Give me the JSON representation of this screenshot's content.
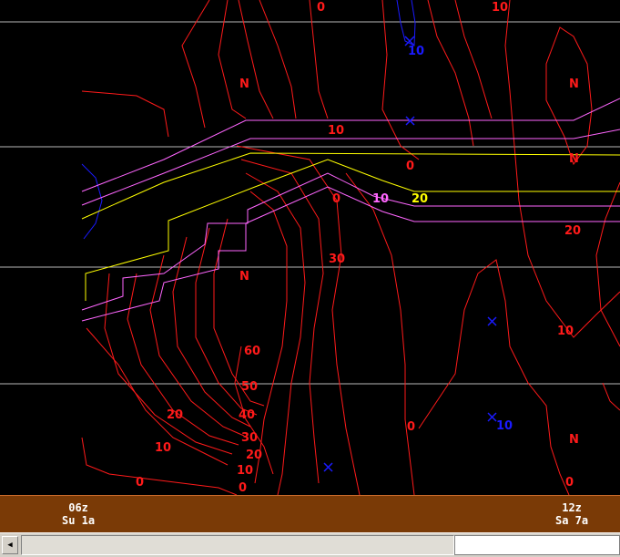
{
  "colors": {
    "background": "#000000",
    "red_contours": "#ff1a1a",
    "blue_contours": "#1a1aff",
    "violet_contours": "#ff66ff",
    "yellow_contours": "#ffff00",
    "grid": "#b8b8b8",
    "timebar": "#7a3a06"
  },
  "plot": {
    "red_labels": [
      "0",
      "10",
      "N",
      "N",
      "10",
      "N",
      "0",
      "20",
      "0",
      "30",
      "N",
      "60",
      "10",
      "50",
      "40",
      "20",
      "30",
      "0",
      "10",
      "20",
      "10",
      "0",
      "0",
      "N",
      "0"
    ],
    "blue_labels": [
      "10",
      "10"
    ],
    "violet_labels": [
      "10"
    ],
    "yellow_labels": [
      "20"
    ],
    "markers": [
      "x-icon",
      "x-icon",
      "x-icon",
      "x-icon",
      "x-icon"
    ]
  },
  "timeline": {
    "labels": [
      {
        "time": "06z",
        "day": "Su 1a"
      },
      {
        "time": "12z",
        "day": "Sa 7a"
      }
    ]
  },
  "scrollbar": {
    "left_arrow": "◀"
  }
}
